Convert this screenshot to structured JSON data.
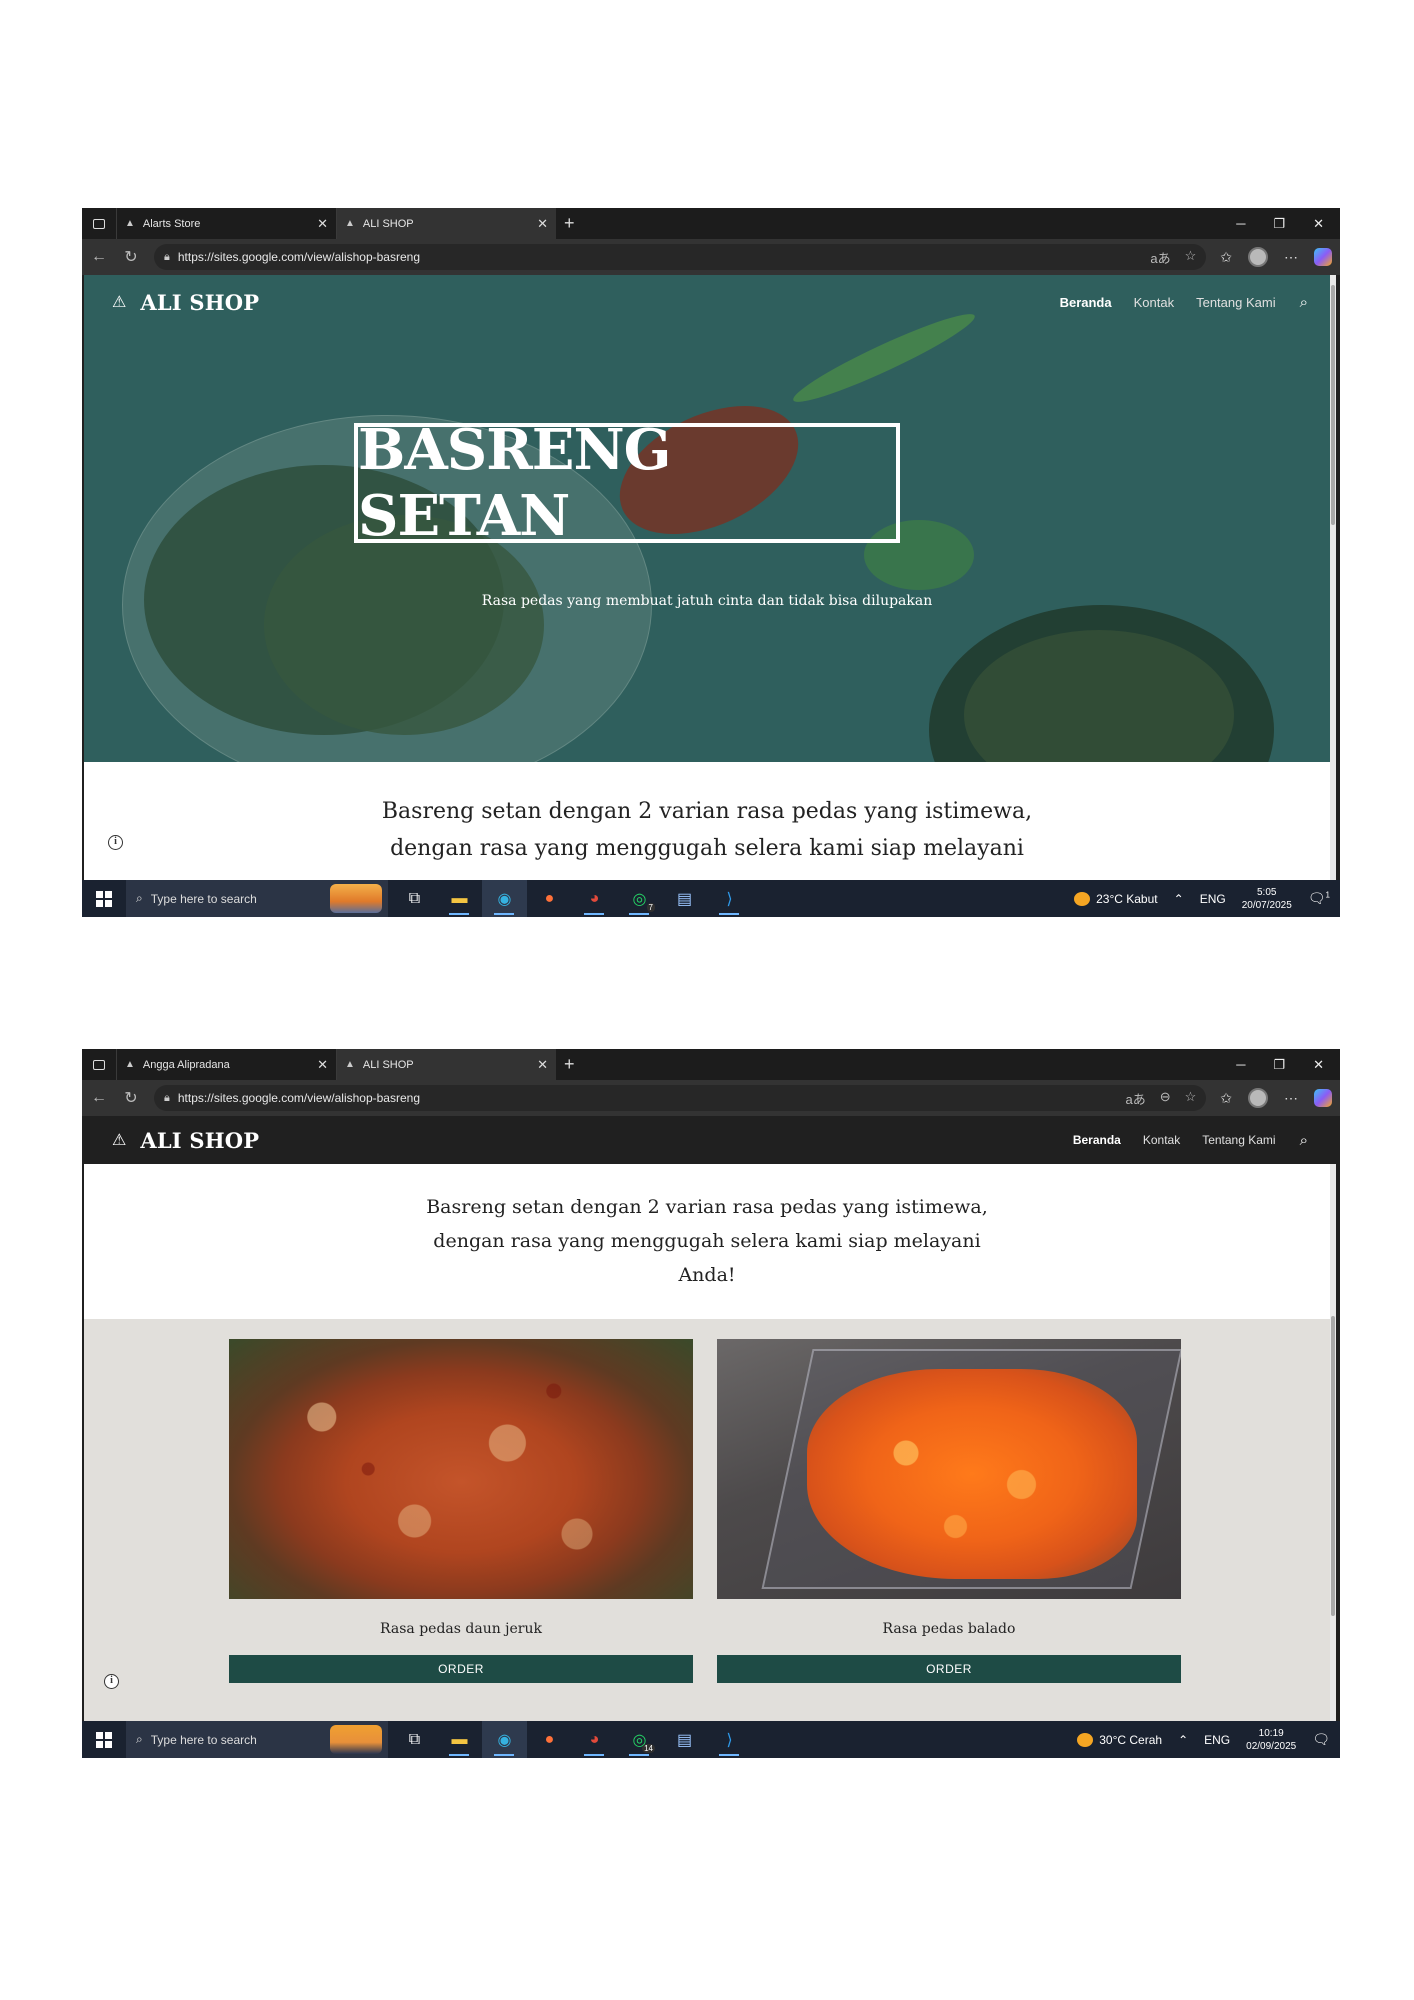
{
  "screenshots": [
    {
      "tabs": [
        {
          "title": "Alarts Store",
          "active": false
        },
        {
          "title": "ALI SHOP",
          "active": true
        }
      ],
      "url": "https://sites.google.com/view/alishop-basreng",
      "site": {
        "title": "ALI SHOP",
        "nav": [
          "Beranda",
          "Kontak",
          "Tentang Kami"
        ]
      },
      "hero": {
        "title": "BASRENG SETAN",
        "subtitle": "Rasa pedas yang membuat jatuh cinta dan tidak bisa dilupakan"
      },
      "intro_lines": [
        "Basreng setan dengan 2 varian rasa pedas yang istimewa,",
        "dengan rasa yang menggugah selera kami siap melayani"
      ],
      "taskbar": {
        "search_placeholder": "Type here to search",
        "whatsapp_badge": "7",
        "weather": "23°C  Kabut",
        "language": "ENG",
        "time": "5:05",
        "date": "20/07/2025",
        "notification_badge": "1"
      }
    },
    {
      "tabs": [
        {
          "title": "Angga Alipradana",
          "active": false
        },
        {
          "title": "ALI SHOP",
          "active": true
        }
      ],
      "url": "https://sites.google.com/view/alishop-basreng",
      "site": {
        "title": "ALI SHOP",
        "nav": [
          "Beranda",
          "Kontak",
          "Tentang Kami"
        ]
      },
      "intro_lines": [
        "Basreng setan dengan 2 varian rasa pedas yang istimewa,",
        "dengan rasa yang menggugah selera kami siap melayani",
        "Anda!"
      ],
      "products": [
        {
          "label": "Rasa pedas daun jeruk",
          "button": "ORDER"
        },
        {
          "label": "Rasa pedas balado",
          "button": "ORDER"
        }
      ],
      "taskbar": {
        "search_placeholder": "Type here to search",
        "whatsapp_badge": "14",
        "weather": "30°C  Cerah",
        "language": "ENG",
        "time": "10:19",
        "date": "02/09/2025"
      }
    }
  ],
  "icons": {
    "window_menu": "window-menu-icon",
    "back": "back-arrow-icon",
    "refresh": "refresh-icon",
    "lock": "lock-icon",
    "star": "favorite-star-icon",
    "search": "search-icon",
    "close": "close-icon"
  },
  "colors": {
    "hero_overlay": "#2f5f5d",
    "order_button": "#1e4b45",
    "products_bg": "#e1dfdb",
    "browser_dark": "#202020",
    "taskbar": "#1a2230"
  }
}
